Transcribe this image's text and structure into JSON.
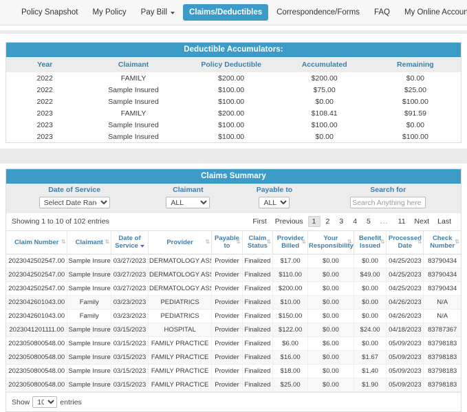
{
  "nav": {
    "items": [
      {
        "label": "Policy Snapshot",
        "active": false,
        "caret": false
      },
      {
        "label": "My Policy",
        "active": false,
        "caret": false
      },
      {
        "label": "Pay Bill",
        "active": false,
        "caret": true
      },
      {
        "label": "Claims/Deductibles",
        "active": true,
        "caret": false
      },
      {
        "label": "Correspondence/Forms",
        "active": false,
        "caret": false
      },
      {
        "label": "FAQ",
        "active": false,
        "caret": false
      },
      {
        "label": "My Online Account",
        "active": false,
        "caret": false
      }
    ]
  },
  "deductible": {
    "title": "Deductible Accumulators:",
    "columns": [
      "Year",
      "Claimant",
      "Policy Deductible",
      "Accumulated",
      "Remaining"
    ],
    "rows": [
      [
        "2022",
        "FAMILY",
        "$200.00",
        "$200.00",
        "$0.00"
      ],
      [
        "2022",
        "Sample Insured",
        "$100.00",
        "$75.00",
        "$25.00"
      ],
      [
        "2022",
        "Sample Insured",
        "$100.00",
        "$0.00",
        "$100.00"
      ],
      [
        "2023",
        "FAMILY",
        "$200.00",
        "$108.41",
        "$91.59"
      ],
      [
        "2023",
        "Sample Insured",
        "$100.00",
        "$100.00",
        "$0.00"
      ],
      [
        "2023",
        "Sample Insured",
        "$100.00",
        "$0.00",
        "$100.00"
      ]
    ]
  },
  "claims": {
    "title": "Claims Summary",
    "filters": {
      "date_of_service": {
        "label": "Date of Service",
        "value": "Select Date Range"
      },
      "claimant": {
        "label": "Claimant",
        "value": "ALL"
      },
      "payable_to": {
        "label": "Payable to",
        "value": "ALL"
      },
      "search": {
        "label": "Search for",
        "value": "",
        "placeholder": "Search Anything here"
      }
    },
    "showing": "Showing 1 to 10 of 102 entries",
    "pagination": {
      "first": "First",
      "previous": "Previous",
      "pages": [
        "1",
        "2",
        "3",
        "4",
        "5",
        "...",
        "11"
      ],
      "active_page": "1",
      "next": "Next",
      "last": "Last"
    },
    "columns": [
      "Claim Number",
      "Claimant",
      "Date of Service",
      "Provider",
      "Payable to",
      "Claim Status",
      "Provider Billed",
      "Your Responsibility",
      "Benefit Issued",
      "Processed Date",
      "Check Number"
    ],
    "sorted_column": "Date of Service",
    "sort_direction": "desc",
    "rows": [
      [
        "2023042502547.00",
        "Sample Insured",
        "03/27/2023",
        "DERMATOLOGY ASSOCIA",
        "Provider",
        "Finalized",
        "$17.00",
        "$0.00",
        "$0.00",
        "04/25/2023",
        "83790434"
      ],
      [
        "2023042502547.00",
        "Sample Insured",
        "03/27/2023",
        "DERMATOLOGY ASSOCIA",
        "Provider",
        "Finalized",
        "$110.00",
        "$0.00",
        "$49.00",
        "04/25/2023",
        "83790434"
      ],
      [
        "2023042502547.00",
        "Sample Insured",
        "03/27/2023",
        "DERMATOLOGY ASSOCIA",
        "Provider",
        "Finalized",
        "$200.00",
        "$0.00",
        "$0.00",
        "04/25/2023",
        "83790434"
      ],
      [
        "2023042601043.00",
        "Family",
        "03/23/2023",
        "PEDIATRICS",
        "Provider",
        "Finalized",
        "$10.00",
        "$0.00",
        "$0.00",
        "04/26/2023",
        "N/A"
      ],
      [
        "2023042601043.00",
        "Family",
        "03/23/2023",
        "PEDIATRICS",
        "Provider",
        "Finalized",
        "$150.00",
        "$0.00",
        "$0.00",
        "04/26/2023",
        "N/A"
      ],
      [
        "2023041201111.00",
        "Sample Insured",
        "03/15/2023",
        "HOSPITAL",
        "Provider",
        "Finalized",
        "$122.00",
        "$0.00",
        "$24.00",
        "04/18/2023",
        "83787367"
      ],
      [
        "2023050800548.00",
        "Sample Insured",
        "03/15/2023",
        "FAMILY PRACTICE",
        "Provider",
        "Finalized",
        "$6.00",
        "$6.00",
        "$0.00",
        "05/09/2023",
        "83798183"
      ],
      [
        "2023050800548.00",
        "Sample Insured",
        "03/15/2023",
        "FAMILY PRACTICE",
        "Provider",
        "Finalized",
        "$16.00",
        "$0.00",
        "$1.67",
        "05/09/2023",
        "83798183"
      ],
      [
        "2023050800548.00",
        "Sample Insured",
        "03/15/2023",
        "FAMILY PRACTICE",
        "Provider",
        "Finalized",
        "$18.00",
        "$0.00",
        "$1.40",
        "05/09/2023",
        "83798183"
      ],
      [
        "2023050800548.00",
        "Sample Insured",
        "03/15/2023",
        "FAMILY PRACTICE",
        "Provider",
        "Finalized",
        "$25.00",
        "$0.00",
        "$1.90",
        "05/09/2023",
        "83798183"
      ]
    ],
    "footer": {
      "show_label": "Show",
      "page_length": "10",
      "entries_label": "entries"
    }
  },
  "colors": {
    "accent_blue": "#3c9cc7",
    "header_text_blue": "#3f7fa6",
    "band_gray": "#ececec",
    "sort_arrow_purple": "#6f5fc4"
  }
}
